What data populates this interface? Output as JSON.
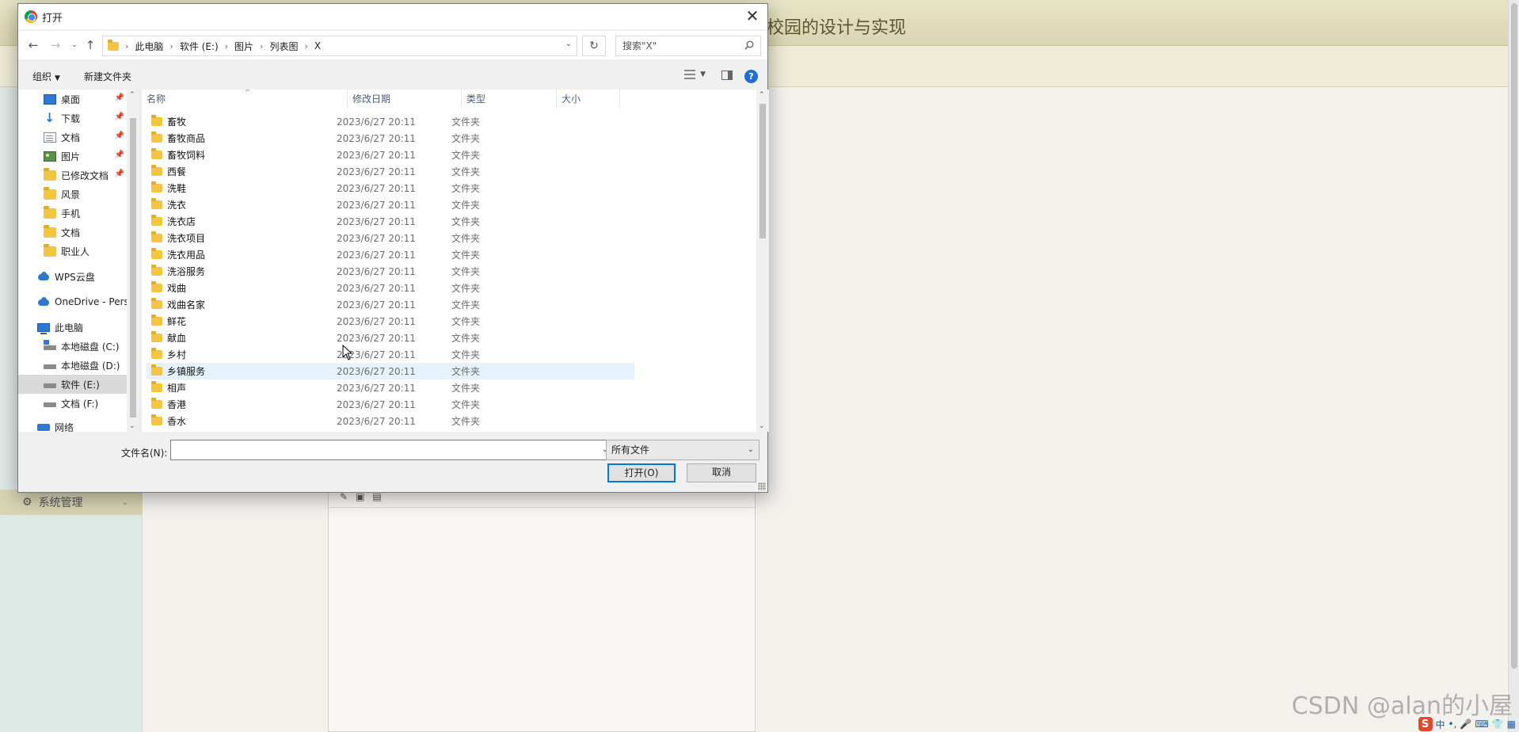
{
  "background": {
    "title_fragment": "校园的设计与实现",
    "side_menu_item": "系统管理",
    "watermark": "CSDN @alan的小屋",
    "ime": [
      "中",
      "•,"
    ]
  },
  "dialog": {
    "title": "打开",
    "breadcrumb": [
      "此电脑",
      "软件 (E:)",
      "图片",
      "列表图",
      "X"
    ],
    "search_placeholder": "搜索\"X\"",
    "toolbar": {
      "organize": "组织",
      "new_folder": "新建文件夹",
      "help": "?"
    },
    "nav_pane": [
      {
        "label": "桌面",
        "icon": "desktop-icon",
        "pinned": true
      },
      {
        "label": "下载",
        "icon": "download-icon",
        "pinned": true
      },
      {
        "label": "文档",
        "icon": "documents-icon",
        "pinned": true
      },
      {
        "label": "图片",
        "icon": "pictures-icon",
        "pinned": true
      },
      {
        "label": "已修改文档",
        "icon": "folder-icon",
        "pinned": true
      },
      {
        "label": "风景",
        "icon": "folder-icon"
      },
      {
        "label": "手机",
        "icon": "folder-icon"
      },
      {
        "label": "文档",
        "icon": "folder-icon"
      },
      {
        "label": "职业人",
        "icon": "folder-icon"
      },
      {
        "label": "WPS云盘",
        "icon": "cloud-icon"
      },
      {
        "label": "OneDrive - Pers",
        "icon": "onedrive-icon"
      },
      {
        "label": "此电脑",
        "icon": "computer-icon"
      },
      {
        "label": "本地磁盘 (C:)",
        "icon": "system-drive-icon"
      },
      {
        "label": "本地磁盘 (D:)",
        "icon": "drive-icon"
      },
      {
        "label": "软件 (E:)",
        "icon": "drive-icon",
        "selected": true
      },
      {
        "label": "文档 (F:)",
        "icon": "drive-icon"
      },
      {
        "label": "网络",
        "icon": "network-icon"
      }
    ],
    "columns": [
      "名称",
      "修改日期",
      "类型",
      "大小"
    ],
    "files": [
      {
        "name": "畜牧",
        "date": "2023/6/27 20:11",
        "type": "文件夹"
      },
      {
        "name": "畜牧商品",
        "date": "2023/6/27 20:11",
        "type": "文件夹"
      },
      {
        "name": "畜牧饲料",
        "date": "2023/6/27 20:11",
        "type": "文件夹"
      },
      {
        "name": "西餐",
        "date": "2023/6/27 20:11",
        "type": "文件夹"
      },
      {
        "name": "洗鞋",
        "date": "2023/6/27 20:11",
        "type": "文件夹"
      },
      {
        "name": "洗衣",
        "date": "2023/6/27 20:11",
        "type": "文件夹"
      },
      {
        "name": "洗衣店",
        "date": "2023/6/27 20:11",
        "type": "文件夹"
      },
      {
        "name": "洗衣项目",
        "date": "2023/6/27 20:11",
        "type": "文件夹"
      },
      {
        "name": "洗衣用品",
        "date": "2023/6/27 20:11",
        "type": "文件夹"
      },
      {
        "name": "洗浴服务",
        "date": "2023/6/27 20:11",
        "type": "文件夹"
      },
      {
        "name": "戏曲",
        "date": "2023/6/27 20:11",
        "type": "文件夹"
      },
      {
        "name": "戏曲名家",
        "date": "2023/6/27 20:11",
        "type": "文件夹"
      },
      {
        "name": "鲜花",
        "date": "2023/6/27 20:11",
        "type": "文件夹"
      },
      {
        "name": "献血",
        "date": "2023/6/27 20:11",
        "type": "文件夹"
      },
      {
        "name": "乡村",
        "date": "2023/6/27 20:11",
        "type": "文件夹"
      },
      {
        "name": "乡镇服务",
        "date": "2023/6/27 20:11",
        "type": "文件夹",
        "highlighted": true
      },
      {
        "name": "相声",
        "date": "2023/6/27 20:11",
        "type": "文件夹"
      },
      {
        "name": "香港",
        "date": "2023/6/27 20:11",
        "type": "文件夹"
      },
      {
        "name": "香水",
        "date": "2023/6/27 20:11",
        "type": "文件夹"
      }
    ],
    "filename_label": "文件名(N):",
    "filename_value": "",
    "file_type_filter": "所有文件",
    "open_button": "打开(O)",
    "cancel_button": "取消"
  }
}
